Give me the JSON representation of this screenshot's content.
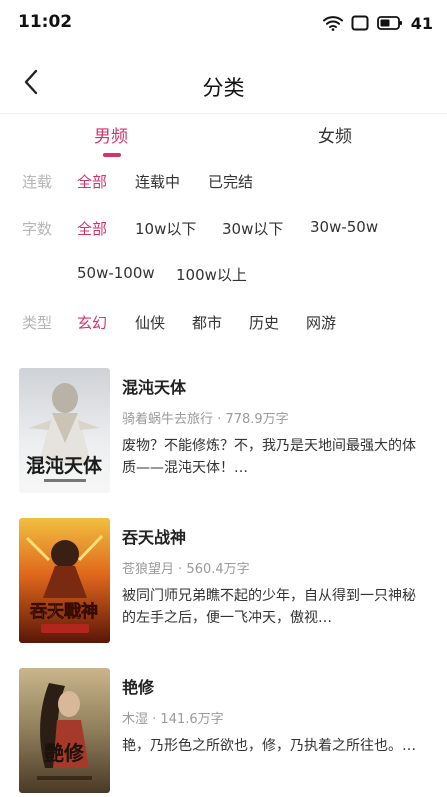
{
  "status_bar": {
    "time": "11:02",
    "battery": "41"
  },
  "nav": {
    "title": "分类"
  },
  "gender_tabs": [
    {
      "label": "男频",
      "active": true
    },
    {
      "label": "女频",
      "active": false
    }
  ],
  "filters": {
    "serial": {
      "label": "连载",
      "options": [
        "全部",
        "连载中",
        "已完结"
      ]
    },
    "words": {
      "label": "字数",
      "options": [
        "全部",
        "10w以下",
        "30w以下",
        "30w-50w",
        "50w-100w",
        "100w以上"
      ]
    },
    "genre": {
      "label": "类型",
      "options": [
        "玄幻",
        "仙侠",
        "都市",
        "历史",
        "网游"
      ]
    }
  },
  "books": [
    {
      "title": "混沌天体",
      "author": "骑着蜗牛去旅行",
      "word_count": "778.9万字",
      "description": "废物？不能修炼？不，我乃是天地间最强大的体质——混沌天体！…",
      "cover_text": "混沌天体"
    },
    {
      "title": "吞天战神",
      "author": "苍狼望月",
      "word_count": "560.4万字",
      "description": "被同门师兄弟瞧不起的少年，自从得到一只神秘的左手之后，便一飞冲天，傲视…",
      "cover_text": "吞天戰神"
    },
    {
      "title": "艳修",
      "author": "木湿",
      "word_count": "141.6万字",
      "description": "艳，乃形色之所欲也，修，乃执着之所往也。…",
      "cover_text": "艷修"
    }
  ],
  "colors": {
    "accent": "#d6336c",
    "muted": "#b5b5b5"
  }
}
